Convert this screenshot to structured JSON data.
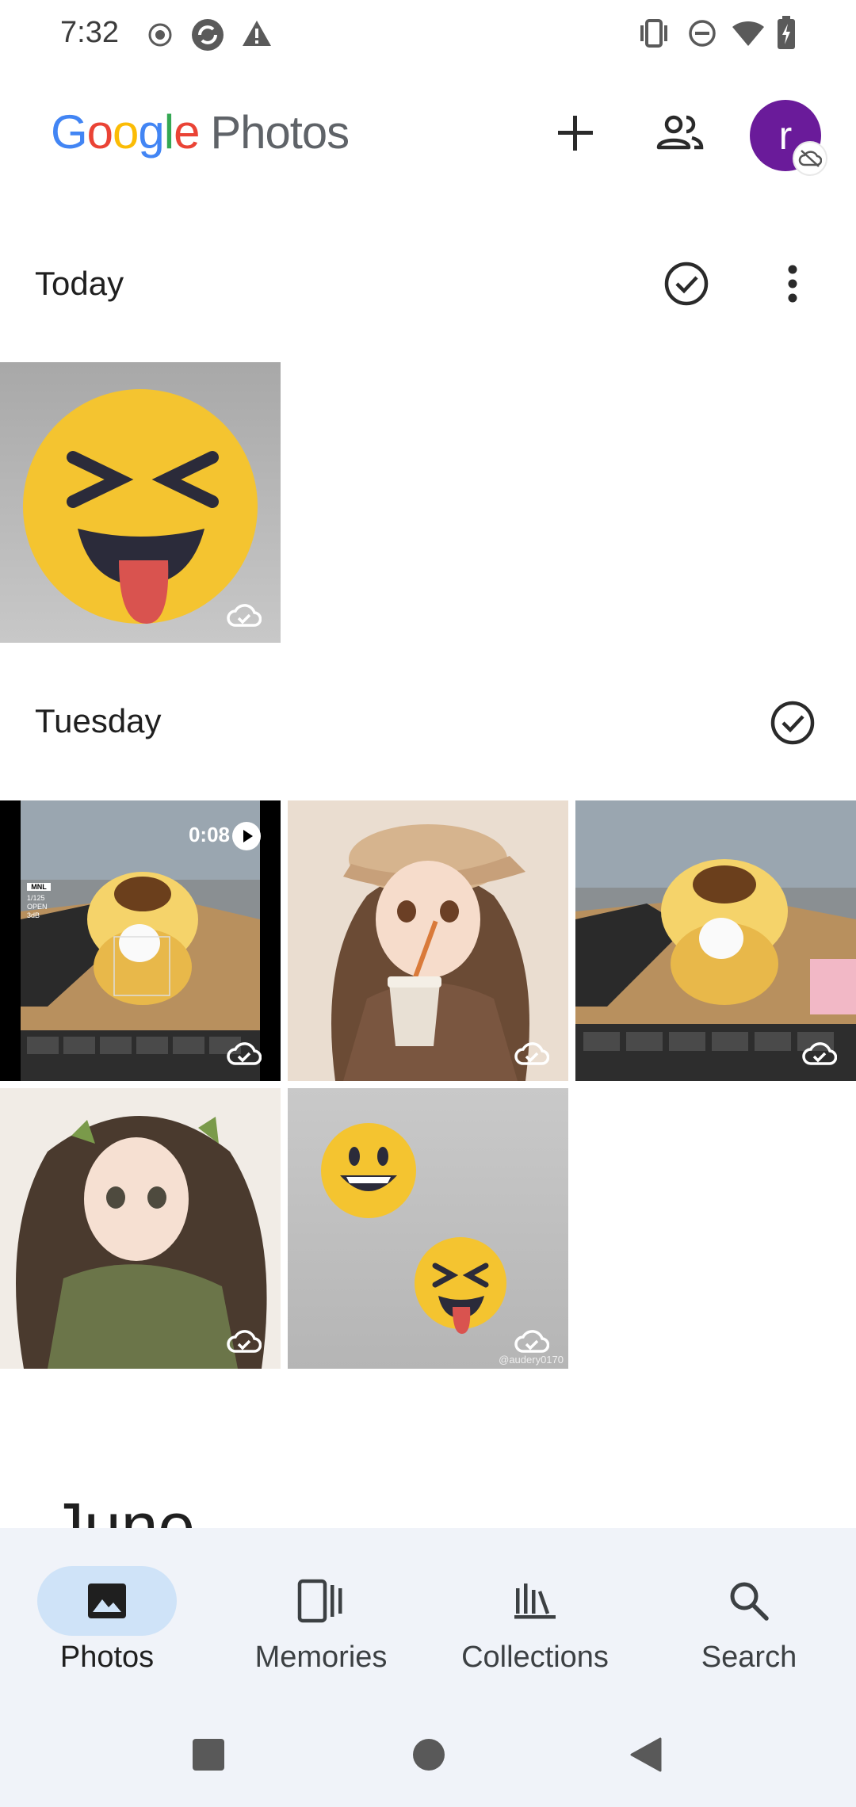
{
  "status_bar": {
    "time": "7:32",
    "left_icons": [
      "record-icon",
      "sync-icon",
      "warning-icon"
    ],
    "right_icons": [
      "vibrate-icon",
      "do-not-disturb-icon",
      "wifi-icon",
      "battery-charging-icon"
    ]
  },
  "app_bar": {
    "logo_google": [
      "G",
      "o",
      "o",
      "g",
      "l",
      "e"
    ],
    "logo_product": "Photos",
    "avatar_letter": "r",
    "actions": [
      "add-icon",
      "shared-icon",
      "backup-off-icon"
    ]
  },
  "sections": [
    {
      "title": "Today",
      "items": [
        {
          "type": "image",
          "content": "emoji-laughing-tongue",
          "backed_up": true
        }
      ]
    },
    {
      "title": "Tuesday",
      "items": [
        {
          "type": "video",
          "duration": "0:08",
          "content": "plush-toy-on-desk",
          "backed_up": true,
          "overlay": [
            "MNL",
            "1/125",
            "OPEN",
            "3dB"
          ]
        },
        {
          "type": "image",
          "content": "girl-with-drink",
          "backed_up": true
        },
        {
          "type": "image",
          "content": "plush-toy-on-desk",
          "backed_up": true
        },
        {
          "type": "image",
          "content": "girl-green-sweater",
          "backed_up": true
        },
        {
          "type": "image",
          "content": "two-emojis",
          "backed_up": true,
          "watermark": "@audery0170"
        }
      ]
    }
  ],
  "next_section": {
    "title": "June"
  },
  "bottom_nav": {
    "items": [
      {
        "label": "Photos",
        "icon": "photo-icon",
        "active": true
      },
      {
        "label": "Memories",
        "icon": "memories-icon",
        "active": false
      },
      {
        "label": "Collections",
        "icon": "collections-icon",
        "active": false
      },
      {
        "label": "Search",
        "icon": "search-icon",
        "active": false
      }
    ]
  },
  "system_nav": [
    "recents-button",
    "home-button",
    "back-button"
  ],
  "colors": {
    "avatar": "#6a1b9a",
    "nav_bg": "#f0f3f9",
    "active_pill": "#cfe3f8"
  }
}
